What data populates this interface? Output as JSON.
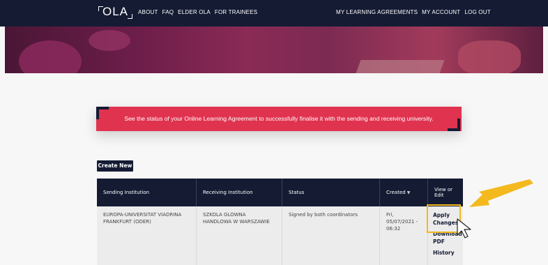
{
  "nav": {
    "logo": "OLA",
    "left_links": [
      "ABOUT",
      "FAQ",
      "ELDER OLA",
      "FOR TRAINEES"
    ],
    "right_links": [
      "MY LEARNING AGREEMENTS",
      "MY ACCOUNT",
      "LOG OUT"
    ]
  },
  "banner": {
    "text": "See the status of your Online Learning Agreement to successfully finalise it with the sending and receiving university."
  },
  "create_button": "Create New",
  "table": {
    "headers": [
      "Sending Institution",
      "Receiving Institution",
      "Status",
      "Created",
      "View or Edit"
    ],
    "rows": [
      {
        "sending": "EUROPA-UNIVERSITAT VIADRINA FRANKFURT (ODER)",
        "receiving": "SZKOLA GLOWNA HANDLOWA W WARSZAWIE",
        "status": "Signed by both coordinators",
        "created": "Fri, 05/07/2021 - 06:32",
        "actions": [
          "Apply Changes",
          "Download PDF",
          "History"
        ]
      }
    ]
  },
  "colors": {
    "navy": "#141b33",
    "banner": "#e0334f",
    "highlight": "#f3b91d"
  }
}
